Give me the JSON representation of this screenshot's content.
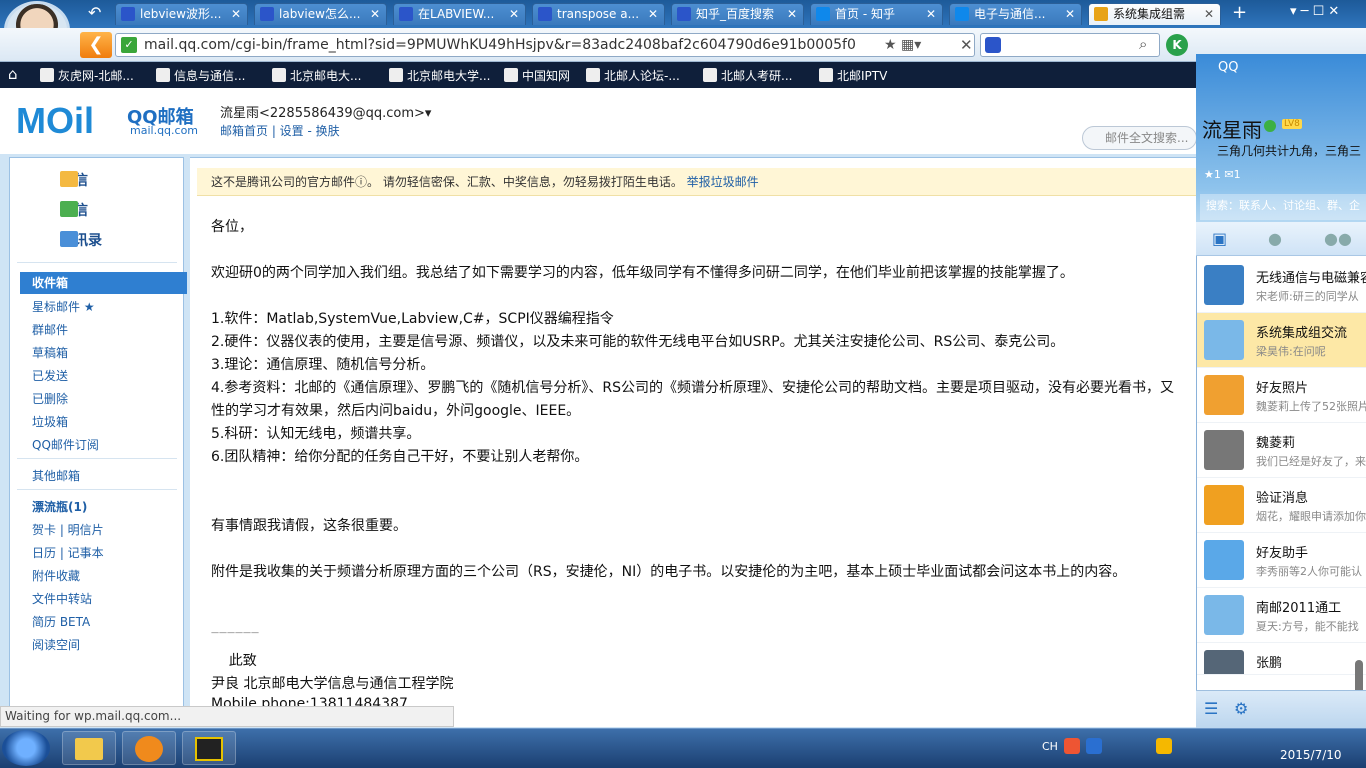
{
  "browser": {
    "tabs": [
      {
        "label": "lebview波形...",
        "icon": "paw-icon",
        "color": "#2b55c9"
      },
      {
        "label": "labview怎么...",
        "icon": "paw-icon",
        "color": "#2b55c9"
      },
      {
        "label": "在LABVIEW...",
        "icon": "paw-icon",
        "color": "#2b55c9"
      },
      {
        "label": "transpose a...",
        "icon": "paw-icon",
        "color": "#2b55c9"
      },
      {
        "label": "知乎_百度搜索",
        "icon": "paw-icon",
        "color": "#2b55c9"
      },
      {
        "label": "首页 - 知乎",
        "icon": "zhihu-icon",
        "color": "#0f88eb"
      },
      {
        "label": "电子与通信...",
        "icon": "zhihu-icon",
        "color": "#0f88eb"
      },
      {
        "label": "系统集成组需",
        "icon": "chrome-icon",
        "color": "#e8a317"
      }
    ],
    "url": "mail.qq.com/cgi-bin/frame_html?sid=9PMUWhKU49hHsjpv&r=83adc2408baf2c604790d6e91b0005f0",
    "bookmarks": [
      "灰虎网-北邮...",
      "信息与通信...",
      "北京邮电大...",
      "北京邮电大学...",
      "中国知网",
      "北邮人论坛-...",
      "北邮人考研...",
      "北邮IPTV"
    ]
  },
  "mail": {
    "logo": "MOil",
    "logo_cn": "QQ邮箱",
    "logo_url": "mail.qq.com",
    "user": "流星雨<2285586439@qq.com>▾",
    "user_links": "邮箱首页 | 设置 - 换肤",
    "search_placeholder": "邮件全文搜索...",
    "nav": {
      "write": "写信",
      "inbox_main": "收信",
      "contacts": "通讯录"
    },
    "folders": {
      "inbox": "收件箱",
      "starred": "星标邮件 ★",
      "group": "群邮件",
      "drafts": "草稿箱",
      "sent": "已发送",
      "deleted": "已删除",
      "spam": "垃圾箱",
      "subscribe": "QQ邮件订阅",
      "other": "其他邮箱",
      "bottle": "漂流瓶(1)",
      "cards": "贺卡 | 明信片",
      "calendar": "日历 | 记事本",
      "attach": "附件收藏",
      "transfer": "文件中转站",
      "resume": "简历 BETA",
      "reading": "阅读空间"
    },
    "warning": "这不是腾讯公司的官方邮件ⓘ。 请勿轻信密保、汇款、中奖信息，勿轻易拨打陌生电话。",
    "warning_link": "举报垃圾邮件",
    "body": [
      "各位，",
      "欢迎研0的两个同学加入我们组。我总结了如下需要学习的内容，低年级同学有不懂得多问研二同学，在他们毕业前把该掌握的技能掌握了。",
      "1.软件：Matlab,SystemVue,Labview,C#，SCPI仪器编程指令",
      "2.硬件：仪器仪表的使用，主要是信号源、频谱仪，以及未来可能的软件无线电平台如USRP。尤其关注安捷伦公司、RS公司、泰克公司。",
      "3.理论：通信原理、随机信号分析。",
      "4.参考资料：北邮的《通信原理》、罗鹏飞的《随机信号分析》、RS公司的《频谱分析原理》、安捷伦公司的帮助文档。主要是项目驱动，没有必要光看书，又",
      "性的学习才有效果，然后内问baidu，外问google、IEEE。",
      "5.科研：认知无线电，频谱共享。",
      "6.团队精神：给你分配的任务自己干好，不要让别人老帮你。",
      "有事情跟我请假，这条很重要。",
      "附件是我收集的关于频谱分析原理方面的三个公司（RS，安捷伦，NI）的电子书。以安捷伦的为主吧，基本上硕士毕业面试都会问这本书上的内容。",
      "——————",
      "    此致",
      "尹良  北京邮电大学信息与通信工程学院",
      "Mobile phone:13811484387"
    ],
    "status": "Waiting for wp.mail.qq.com..."
  },
  "qq": {
    "title": "QQ",
    "name": "流星雨",
    "level": "LV8",
    "signature": "三角几何共计九角，三角三",
    "stats": "★1  ✉1",
    "search": "搜索：联系人、讨论组、群、企",
    "items": [
      {
        "name": "无线通信与电磁兼容",
        "msg": "宋老师:研三的同学从",
        "color": "#3a7fc4"
      },
      {
        "name": "系统集成组交流",
        "msg": "梁昊伟:在问呢",
        "color": "#7ab8e8"
      },
      {
        "name": "好友照片",
        "msg": "魏菱莉上传了52张照片",
        "color": "#f0a030"
      },
      {
        "name": "魏菱莉",
        "msg": "我们已经是好友了，来",
        "color": "#777777"
      },
      {
        "name": "验证消息",
        "msg": "烟花，耀眼申请添加你",
        "color": "#f0a020"
      },
      {
        "name": "好友助手",
        "msg": "李秀丽等2人你可能认",
        "color": "#5aa8e8"
      },
      {
        "name": "南邮2011通工",
        "msg": "夏天:方号，能不能找",
        "color": "#7ab8e8"
      },
      {
        "name": "张鹏",
        "msg": "",
        "color": "#556677"
      }
    ]
  },
  "taskbar": {
    "clock": "2015/7/10",
    "lang": "CH"
  }
}
